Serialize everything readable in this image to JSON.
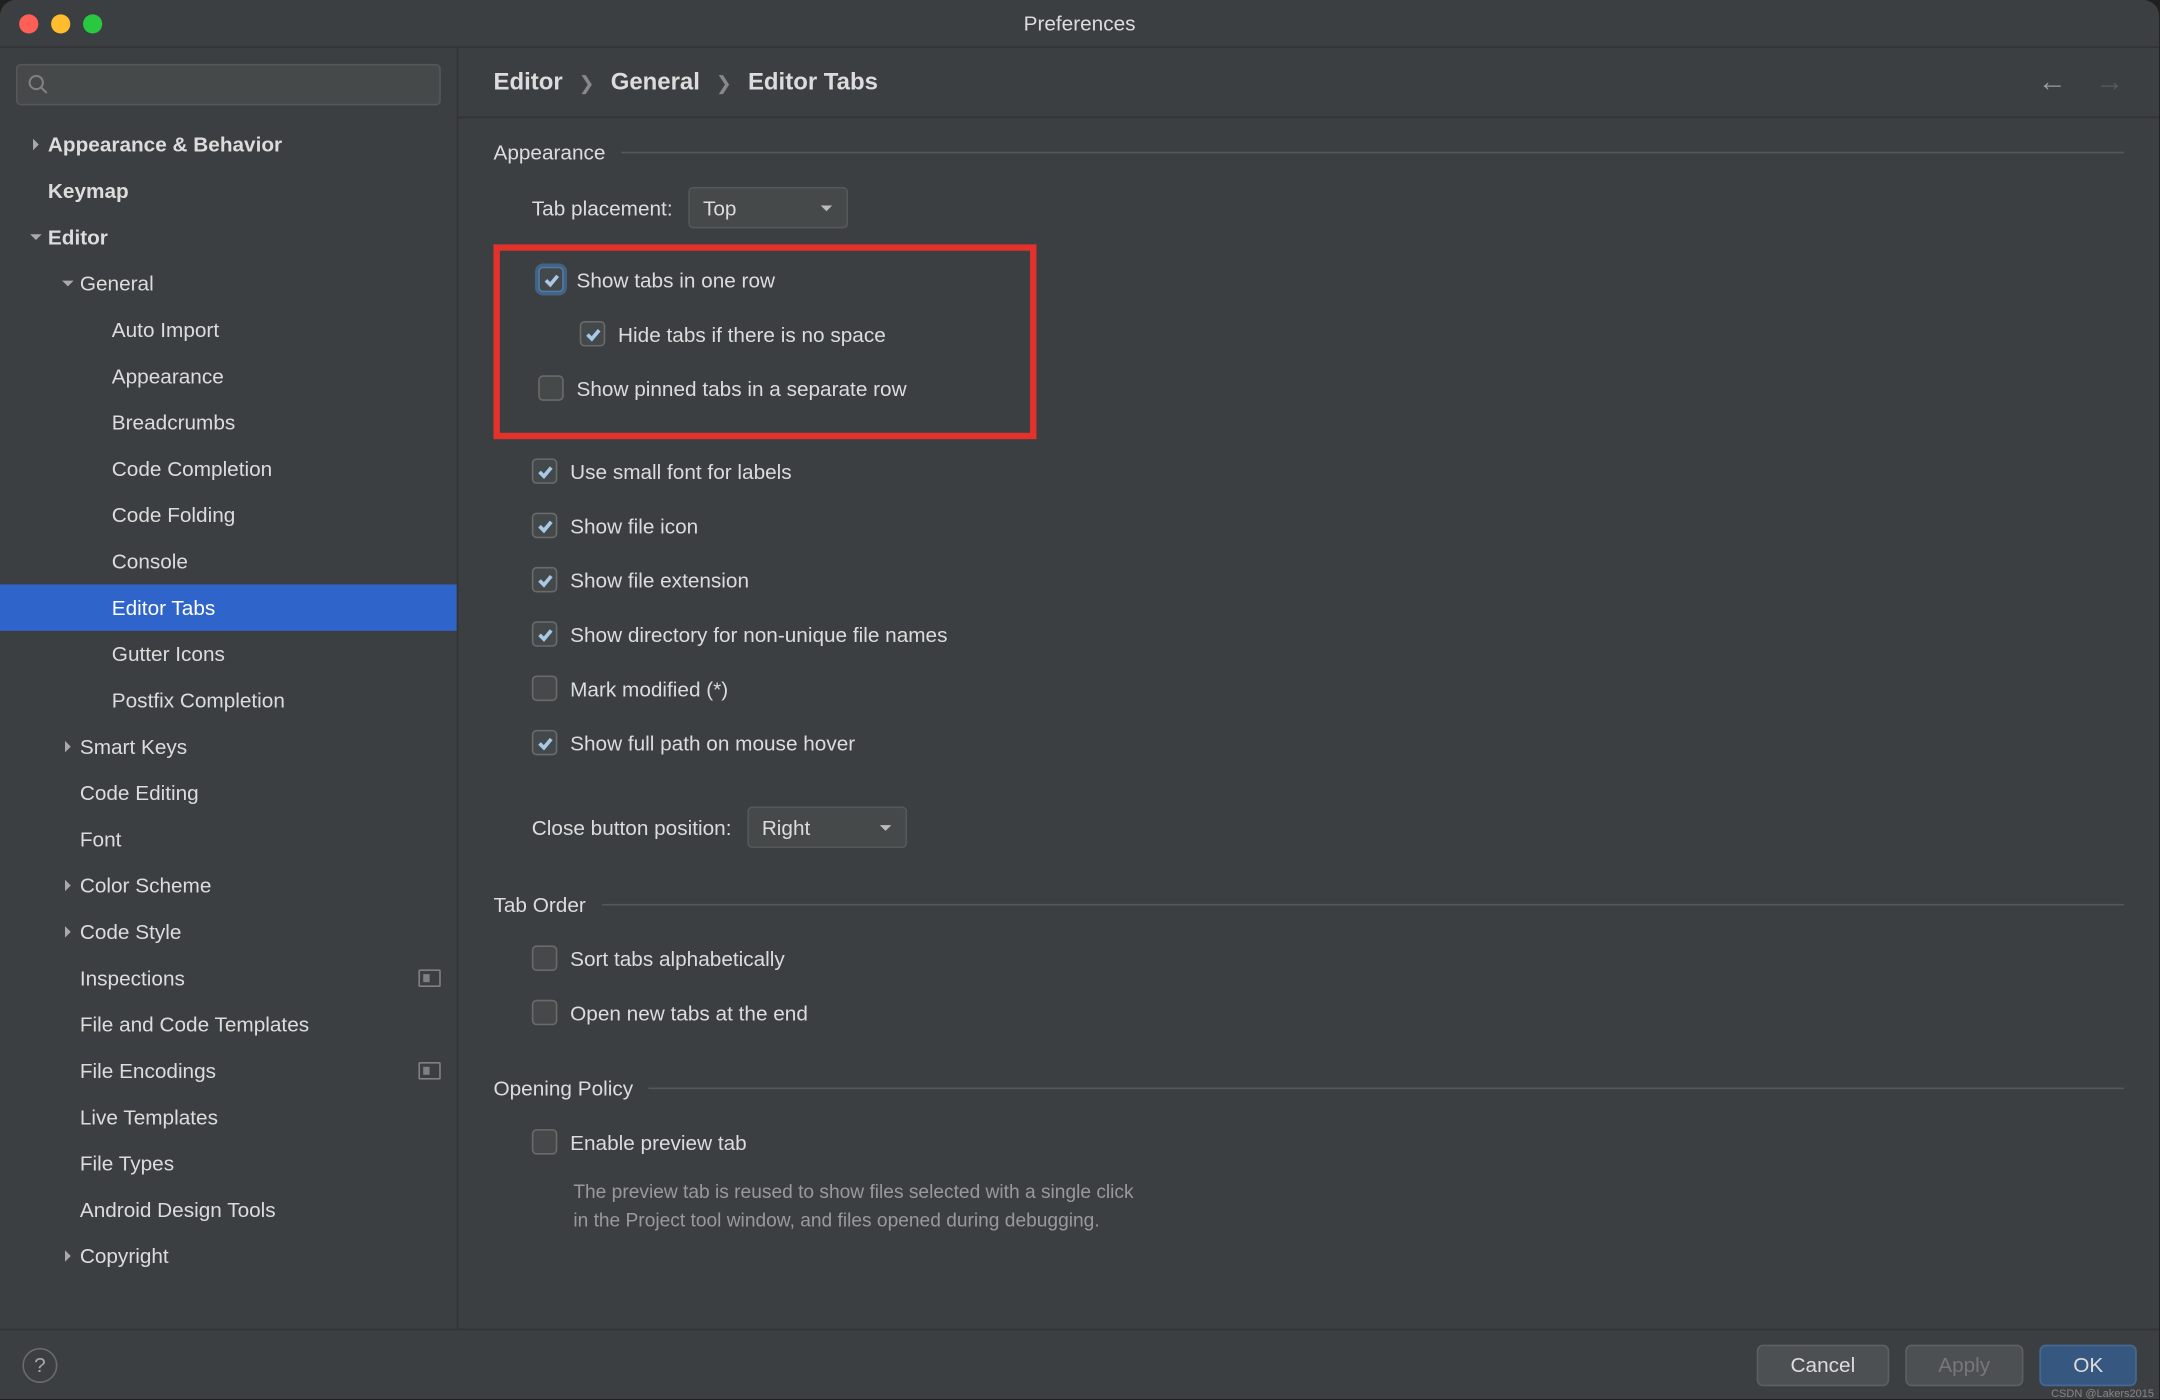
{
  "window": {
    "title": "Preferences"
  },
  "search": {
    "placeholder": ""
  },
  "sidebar": {
    "items": [
      {
        "label": "Appearance & Behavior",
        "depth": 0,
        "arrow": "right",
        "bold": true
      },
      {
        "label": "Keymap",
        "depth": 0,
        "arrow": "none",
        "bold": true
      },
      {
        "label": "Editor",
        "depth": 0,
        "arrow": "down",
        "bold": true
      },
      {
        "label": "General",
        "depth": 1,
        "arrow": "down"
      },
      {
        "label": "Auto Import",
        "depth": 2,
        "arrow": "none"
      },
      {
        "label": "Appearance",
        "depth": 2,
        "arrow": "none"
      },
      {
        "label": "Breadcrumbs",
        "depth": 2,
        "arrow": "none"
      },
      {
        "label": "Code Completion",
        "depth": 2,
        "arrow": "none"
      },
      {
        "label": "Code Folding",
        "depth": 2,
        "arrow": "none"
      },
      {
        "label": "Console",
        "depth": 2,
        "arrow": "none"
      },
      {
        "label": "Editor Tabs",
        "depth": 2,
        "arrow": "none",
        "selected": true
      },
      {
        "label": "Gutter Icons",
        "depth": 2,
        "arrow": "none"
      },
      {
        "label": "Postfix Completion",
        "depth": 2,
        "arrow": "none"
      },
      {
        "label": "Smart Keys",
        "depth": 1,
        "arrow": "right"
      },
      {
        "label": "Code Editing",
        "depth": 1,
        "arrow": "none"
      },
      {
        "label": "Font",
        "depth": 1,
        "arrow": "none"
      },
      {
        "label": "Color Scheme",
        "depth": 1,
        "arrow": "right"
      },
      {
        "label": "Code Style",
        "depth": 1,
        "arrow": "right"
      },
      {
        "label": "Inspections",
        "depth": 1,
        "arrow": "none",
        "badge": true
      },
      {
        "label": "File and Code Templates",
        "depth": 1,
        "arrow": "none"
      },
      {
        "label": "File Encodings",
        "depth": 1,
        "arrow": "none",
        "badge": true
      },
      {
        "label": "Live Templates",
        "depth": 1,
        "arrow": "none"
      },
      {
        "label": "File Types",
        "depth": 1,
        "arrow": "none"
      },
      {
        "label": "Android Design Tools",
        "depth": 1,
        "arrow": "none"
      },
      {
        "label": "Copyright",
        "depth": 1,
        "arrow": "right"
      }
    ]
  },
  "breadcrumbs": [
    "Editor",
    "General",
    "Editor Tabs"
  ],
  "appearance": {
    "section": "Appearance",
    "tab_placement_label": "Tab placement:",
    "tab_placement_value": "Top",
    "show_one_row": "Show tabs in one row",
    "hide_no_space": "Hide tabs if there is no space",
    "pinned_separate": "Show pinned tabs in a separate row",
    "small_font": "Use small font for labels",
    "file_icon": "Show file icon",
    "file_ext": "Show file extension",
    "dir_nonunique": "Show directory for non-unique file names",
    "mark_modified": "Mark modified (*)",
    "full_path_hover": "Show full path on mouse hover",
    "close_btn_label": "Close button position:",
    "close_btn_value": "Right"
  },
  "tab_order": {
    "section": "Tab Order",
    "sort_alpha": "Sort tabs alphabetically",
    "open_end": "Open new tabs at the end"
  },
  "opening": {
    "section": "Opening Policy",
    "preview": "Enable preview tab",
    "preview_hint": "The preview tab is reused to show files selected with a single click\nin the Project tool window, and files opened during debugging."
  },
  "footer": {
    "cancel": "Cancel",
    "apply": "Apply",
    "ok": "OK"
  },
  "watermark": "CSDN @Lakers2015"
}
